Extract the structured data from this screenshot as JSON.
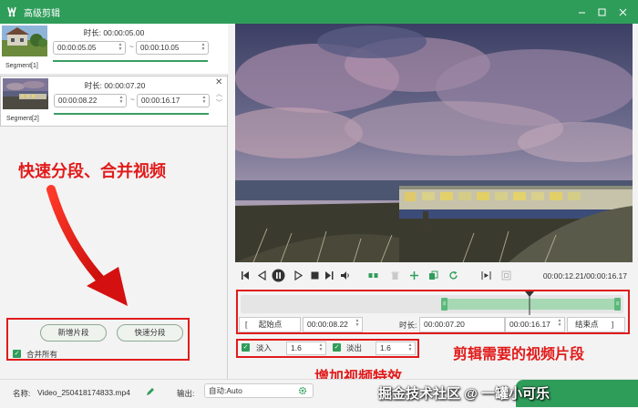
{
  "window": {
    "title": "高级剪辑"
  },
  "segments": [
    {
      "label": "Segment[1]",
      "duration": "时长:  00:00:05.00",
      "start": "00:00:05.05",
      "end": "00:00:10.05"
    },
    {
      "label": "Segment[2]",
      "duration": "时长:  00:00:07.20",
      "start": "00:00:08.22",
      "end": "00:00:16.17"
    }
  ],
  "tilde": "~",
  "annotations": {
    "left_caption": "快速分段、合并视频",
    "right_caption": "剪辑需要的视频片段",
    "bottom_caption": "增加视频特效"
  },
  "buttons": {
    "add_segment": "新增片段",
    "quick_split": "快速分段",
    "merge_all": "合并所有"
  },
  "player": {
    "timecode": "00:00:12.21/00:00:16.17"
  },
  "trim": {
    "start_label": "起始点",
    "start_value": "00:00:08.22",
    "duration_label": "时长:",
    "duration_value": "00:00:07.20",
    "end_value": "00:00:16.17",
    "end_label": "结束点",
    "bracket_open": "[",
    "bracket_close": "]"
  },
  "effects": {
    "fade_in_label": "淡入",
    "fade_in_value": "1.6",
    "fade_out_label": "淡出",
    "fade_out_value": "1.6"
  },
  "bottom": {
    "name_label": "名称:",
    "file_name": "Video_250418174833.mp4",
    "output_label": "输出:",
    "output_value": "自动:Auto"
  },
  "watermark": "掘金技术社区 @ 一罐小可乐",
  "colors": {
    "accent": "#2f9d5a",
    "annotation": "#e11b1b",
    "track_fill": "#a6d8b4"
  }
}
